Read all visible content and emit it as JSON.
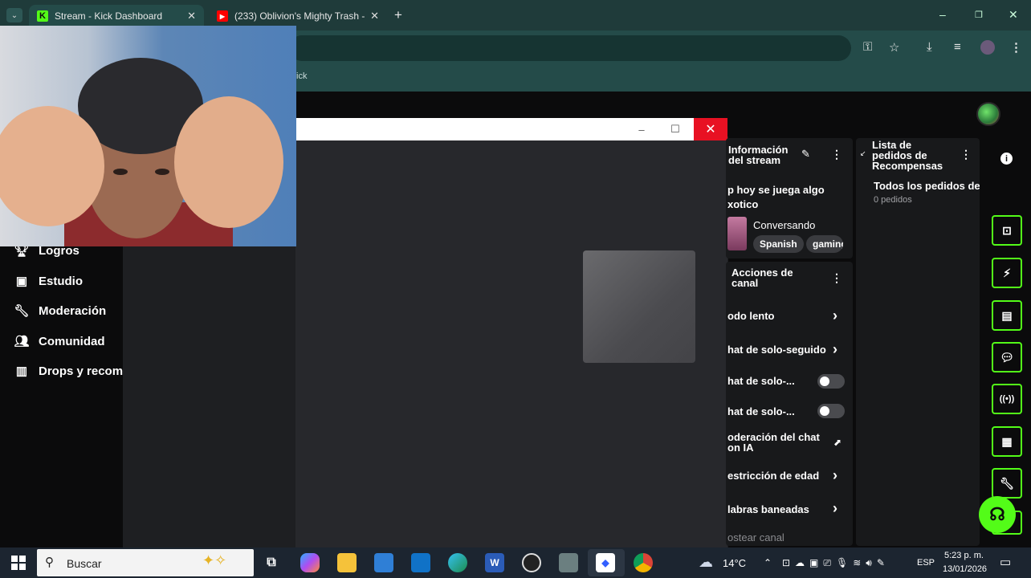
{
  "browser": {
    "tabs": [
      {
        "label": "Stream - Kick Dashboard",
        "active": true
      },
      {
        "label": "(233) Oblivion's Mighty Trash -",
        "active": false
      }
    ],
    "bookmark_text": "ick"
  },
  "sidebar": {
    "items": [
      {
        "label": "Logros",
        "icon": "trophy-icon"
      },
      {
        "label": "Estudio",
        "icon": "studio-icon"
      },
      {
        "label": "Moderación",
        "icon": "wrench-icon"
      },
      {
        "label": "Comunidad",
        "icon": "community-icon"
      },
      {
        "label": "Drops y recom",
        "icon": "drops-icon"
      }
    ]
  },
  "stream_info": {
    "title": "Información del stream",
    "stream_title": "p hoy se juega algo xotico",
    "category": "Conversando",
    "tags": [
      "Spanish",
      "gaming"
    ]
  },
  "rewards": {
    "title": "Lista de pedidos de Recompensas",
    "filter": "Todos los pedidos de",
    "count": "0 pedidos"
  },
  "channel_actions": {
    "title": "Acciones de canal",
    "rows": [
      {
        "label": "odo lento",
        "control": "chevron"
      },
      {
        "label": "hat de solo-seguido",
        "control": "chevron"
      },
      {
        "label": "hat de solo-...",
        "control": "toggle"
      },
      {
        "label": "hat de solo-...",
        "control": "toggle"
      },
      {
        "label": "oderación del chat on IA",
        "control": "external"
      },
      {
        "label": "estricción de edad",
        "control": "chevron"
      },
      {
        "label": "labras baneadas",
        "control": "chevron"
      },
      {
        "label": "ostear canal",
        "control": "none"
      }
    ]
  },
  "taskbar": {
    "search_placeholder": "Buscar",
    "weather": "14°C",
    "language": "ESP",
    "time": "5:23 p. m.",
    "date": "13/01/2026"
  },
  "colors": {
    "kick_green": "#53fc18",
    "close_red": "#e81123",
    "chrome_teal": "#244b49"
  }
}
